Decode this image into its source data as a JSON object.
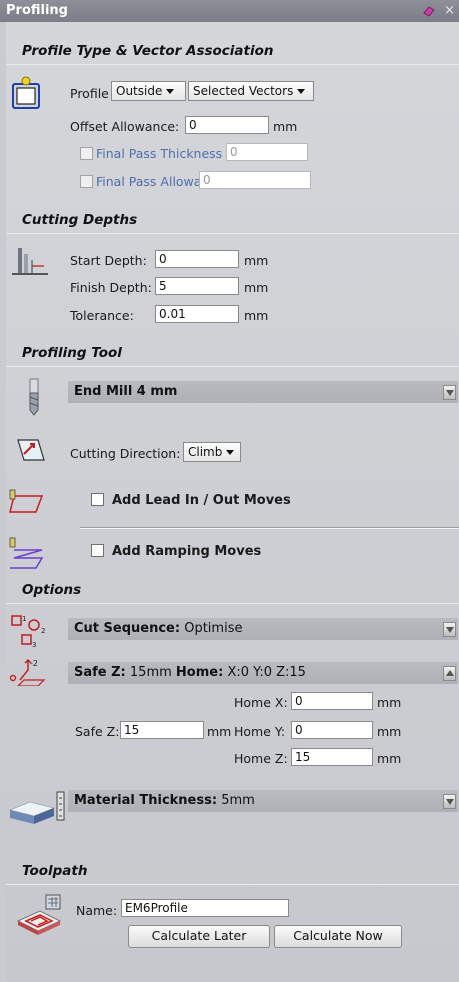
{
  "window": {
    "title": "Profiling"
  },
  "sections": {
    "profile_type": "Profile Type & Vector Association",
    "cutting_depths": "Cutting Depths",
    "profiling_tool": "Profiling Tool",
    "options": "Options",
    "toolpath": "Toolpath"
  },
  "profile": {
    "label": "Profile",
    "type_value": "Outside",
    "vectors_value": "Selected Vectors",
    "offset_label": "Offset Allowance:",
    "offset_value": "0",
    "unit": "mm",
    "final_pass_thickness_label": "Final Pass Thickness",
    "final_pass_thickness_value": "0",
    "final_pass_allowance_label": "Final Pass Allowance",
    "final_pass_allowance_value": "0"
  },
  "depths": {
    "start_label": "Start Depth:",
    "start_value": "0",
    "finish_label": "Finish Depth:",
    "finish_value": "5",
    "tolerance_label": "Tolerance:",
    "tolerance_value": "0.01",
    "unit": "mm"
  },
  "tool": {
    "name": "End Mill 4 mm",
    "cutting_direction_label": "Cutting Direction:",
    "cutting_direction_value": "Climb",
    "lead_in_label": "Add Lead In / Out Moves",
    "ramping_label": "Add Ramping Moves"
  },
  "options": {
    "cut_sequence_label": "Cut Sequence:",
    "cut_sequence_value": "Optimise",
    "safez_bar_label": "Safe Z:",
    "safez_bar_value": "15mm",
    "home_bar_label": "Home:",
    "home_bar_value": "X:0 Y:0 Z:15",
    "safe_z_label": "Safe Z:",
    "safe_z_value": "15",
    "home_x_label": "Home X:",
    "home_x_value": "0",
    "home_y_label": "Home Y:",
    "home_y_value": "0",
    "home_z_label": "Home Z:",
    "home_z_value": "15",
    "unit": "mm",
    "material_label": "Material Thickness:",
    "material_value": "5mm"
  },
  "toolpath": {
    "name_label": "Name:",
    "name_value": "EM6Profile",
    "calc_later": "Calculate Later",
    "calc_now": "Calculate Now"
  }
}
